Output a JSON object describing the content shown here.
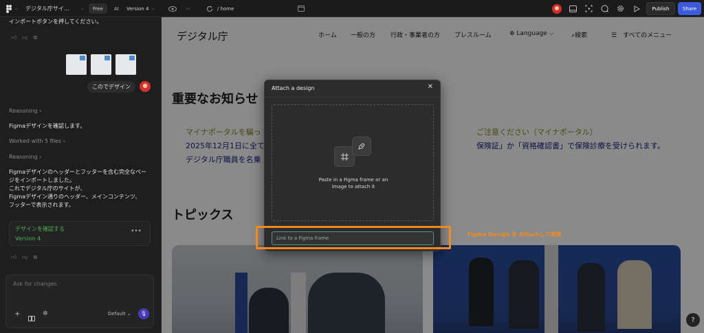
{
  "topbar": {
    "project_title": "デジタル庁サイ...",
    "plan": "Free",
    "ai": "AI",
    "version": "Version 4",
    "url": "/ home",
    "publish_label": "Publish",
    "share_label": "Share"
  },
  "sidebar": {
    "intro_text": "インポートボタンを押してください。",
    "user_message": "このでデザイン",
    "reasoning_1": "Reasoning",
    "confirm_text": "Figmaデザインを確認します。",
    "worked_with": "Worked with 5 files",
    "reasoning_2": "Reasoning",
    "summary_lines": [
      "Figmaデザインのヘッダーとフッターを含む完全なペー",
      "ジをインポートしました。",
      "これでデジタル庁のサイトが、",
      "Figmaデザイン通りのヘッダー、メインコンテンツ、",
      "フッターで表示されます。"
    ],
    "card_title": "デザインを確認する",
    "card_version": "Version 4",
    "ask_placeholder": "Ask for changes",
    "model": "Default"
  },
  "site": {
    "logo": "デジタル庁",
    "nav": {
      "home": "ホーム",
      "general": "一般の方",
      "gov": "行政・事業者の方",
      "press": "プレスルーム",
      "language": "Language",
      "search": "検索",
      "menu": "すべてのメニュー"
    },
    "notice_heading": "重要なお知らせ",
    "notice_line_1a": "マイナポータルを騙っ",
    "notice_line_1b": "ご注意ください（マイナポータル）",
    "notice_line_2a": "2025年12月1日に全ての",
    "notice_line_2b": "保険証」か「資格確認書」で保険診療を受けられます。",
    "notice_line_3": "デジタル庁職員を名乗",
    "topics_heading": "トピックス"
  },
  "modal": {
    "title": "Attach a design",
    "drop_line_1": "Paste in a Figma frame or an",
    "drop_line_2": "image to attach it",
    "link_placeholder": "Link to a Figma frame"
  },
  "annotation": "Figma Design を Attachして実装",
  "colors": {
    "accent_blue": "#3b5bdb",
    "highlight_orange": "#f28a22",
    "version_green": "#4caf50",
    "notice_olive": "#8a8a1e",
    "notice_blue": "#1a237e"
  }
}
